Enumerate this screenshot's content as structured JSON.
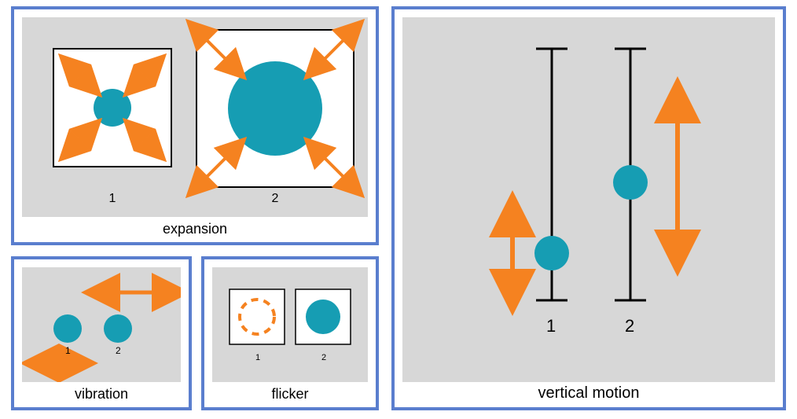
{
  "colors": {
    "accent_border": "#5a7ece",
    "panel_bg": "#d7d7d7",
    "circle": "#169db3",
    "arrow": "#f58220"
  },
  "panels": {
    "expansion": {
      "caption": "expansion",
      "items": [
        {
          "label": "1",
          "state": "small circle, arrows inward"
        },
        {
          "label": "2",
          "state": "large circle, arrows outward"
        }
      ]
    },
    "vibration": {
      "caption": "vibration",
      "items": [
        {
          "label": "1",
          "direction": "left"
        },
        {
          "label": "2",
          "direction": "right"
        }
      ]
    },
    "flicker": {
      "caption": "flicker",
      "items": [
        {
          "label": "1",
          "state": "dashed outline"
        },
        {
          "label": "2",
          "state": "filled"
        }
      ]
    },
    "vertical": {
      "caption": "vertical motion",
      "items": [
        {
          "label": "1",
          "position": "low",
          "arrow": "short"
        },
        {
          "label": "2",
          "position": "high",
          "arrow": "long"
        }
      ]
    }
  }
}
